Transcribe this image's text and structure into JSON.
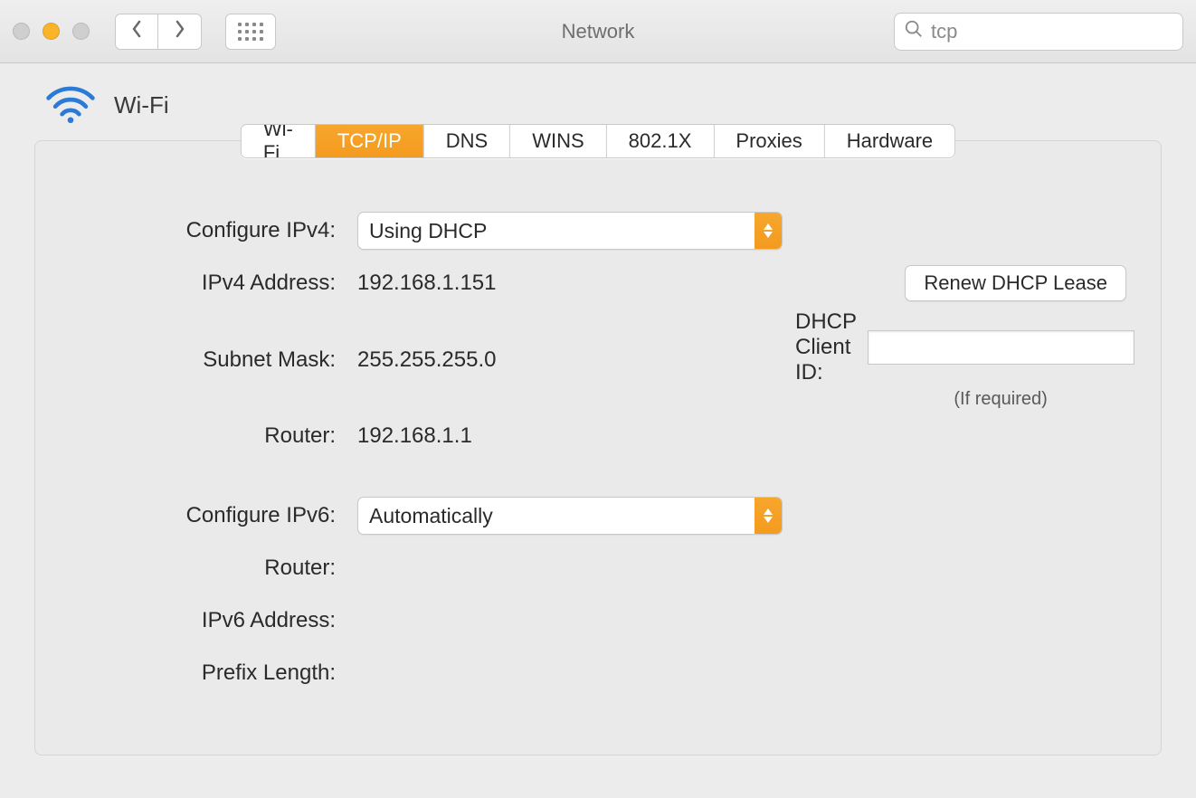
{
  "window": {
    "title": "Network"
  },
  "search": {
    "value": "tcp"
  },
  "header": {
    "interface": "Wi-Fi"
  },
  "tabs": {
    "items": [
      "Wi-Fi",
      "TCP/IP",
      "DNS",
      "WINS",
      "802.1X",
      "Proxies",
      "Hardware"
    ],
    "active": "TCP/IP"
  },
  "labels": {
    "configure_ipv4": "Configure IPv4:",
    "ipv4_address": "IPv4 Address:",
    "subnet_mask": "Subnet Mask:",
    "router_v4": "Router:",
    "configure_ipv6": "Configure IPv6:",
    "router_v6": "Router:",
    "ipv6_address": "IPv6 Address:",
    "prefix_length": "Prefix Length:",
    "dhcp_client_id": "DHCP Client ID:",
    "if_required": "(If required)"
  },
  "values": {
    "configure_ipv4": "Using DHCP",
    "ipv4_address": "192.168.1.151",
    "subnet_mask": "255.255.255.0",
    "router_v4": "192.168.1.1",
    "configure_ipv6": "Automatically",
    "router_v6": "",
    "ipv6_address": "",
    "prefix_length": "",
    "dhcp_client_id": ""
  },
  "buttons": {
    "renew_dhcp": "Renew DHCP Lease"
  }
}
